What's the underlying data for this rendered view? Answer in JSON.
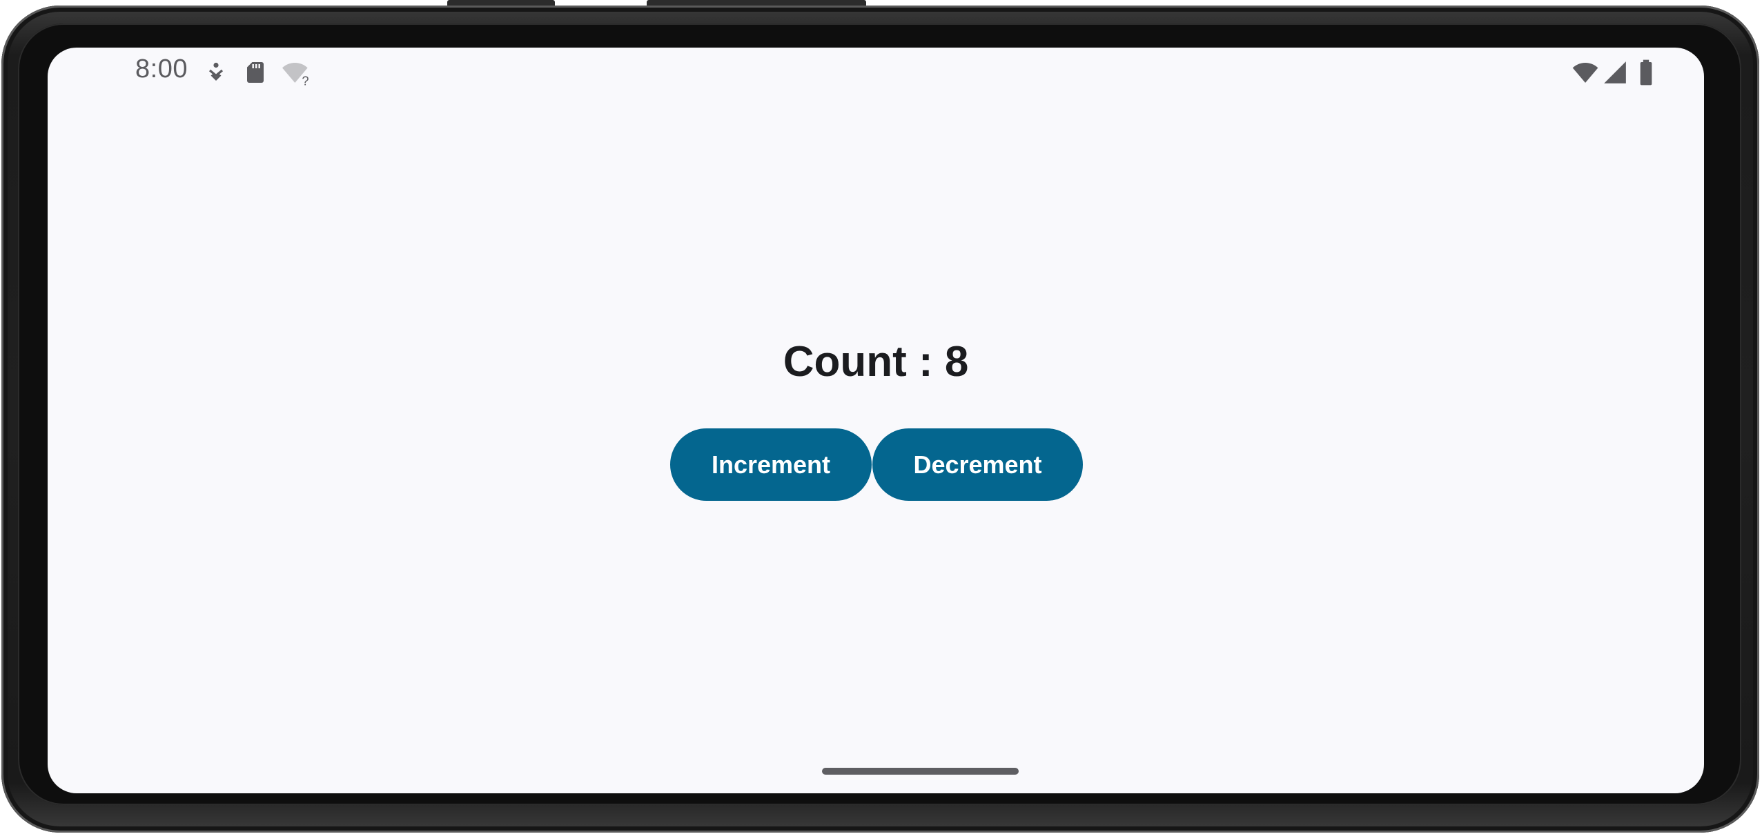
{
  "status_bar": {
    "time": "8:00",
    "left_icons": [
      "accessibility-download-icon",
      "sd-card-icon",
      "wifi-question-icon"
    ],
    "right_icons": [
      "wifi-icon",
      "cellular-signal-icon",
      "battery-icon"
    ]
  },
  "content": {
    "count_text": "Count : 8",
    "increment_label": "Increment",
    "decrement_label": "Decrement"
  },
  "colors": {
    "button_background": "#04668f",
    "button_text": "#ffffff",
    "screen_background": "#f9f9fc",
    "text_primary": "#1b1c1f",
    "status_icons": "#5b5b5f"
  }
}
